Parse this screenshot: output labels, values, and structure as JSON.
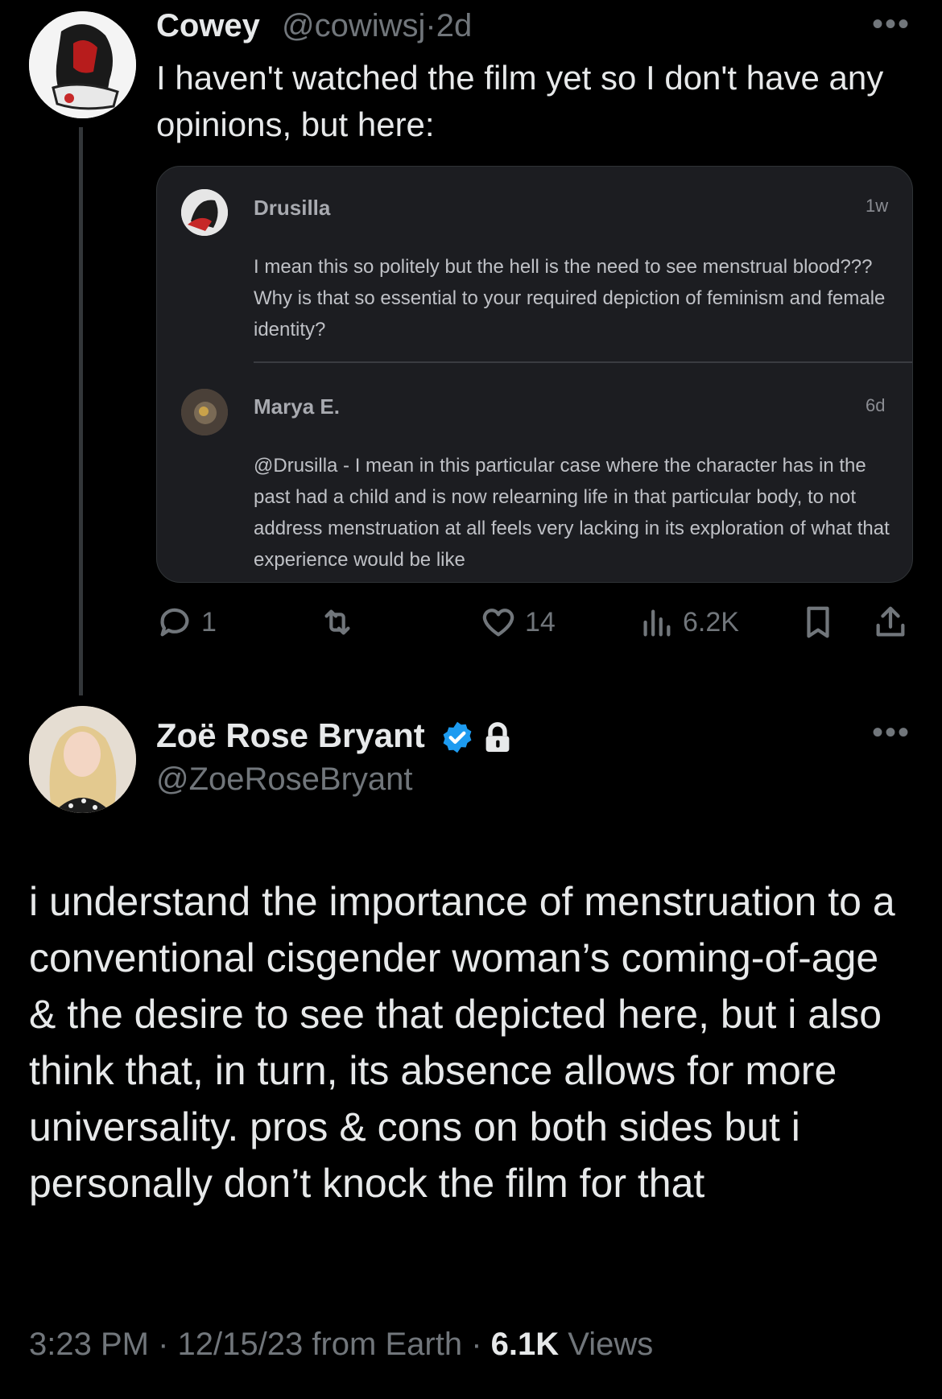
{
  "parent_tweet": {
    "author_name": "Cowey",
    "handle": "@cowiwsj",
    "separator": "·",
    "time": "2d",
    "more": "•••",
    "text": "I haven't watched the film yet so I don't have any opinions, but here:",
    "embedded": {
      "comments": [
        {
          "name": "Drusilla",
          "time": "1w",
          "text": "I mean this so politely but the hell is the need to see menstrual blood??? Why is that so essential to your required depiction of feminism and female identity?"
        },
        {
          "name": "Marya E.",
          "time": "6d",
          "text": "@Drusilla - I mean in this particular case where the character has in the past had a child and is now relearning life in that particular body, to not address menstruation at all feels very lacking in its exploration of what that experience would be like"
        }
      ]
    },
    "actions": {
      "replies": "1",
      "retweets": "",
      "likes": "14",
      "views": "6.2K"
    }
  },
  "main_tweet": {
    "author_name": "Zoë Rose Bryant",
    "handle": "@ZoeRoseBryant",
    "more": "•••",
    "text": "i understand the importance of menstruation to a conventional cisgender woman’s coming-of-age & the desire to see that depicted here, but i also think that, in turn, its absence allows for more universality. pros & cons on both sides but i personally don’t knock the film for that",
    "footer": {
      "time": "3:23 PM",
      "sep1": "·",
      "date": "12/15/23 from Earth",
      "sep2": "·",
      "views_count": "6.1K",
      "views_label": "Views"
    }
  },
  "colors": {
    "background": "#000000",
    "text": "#e7e9ea",
    "secondary": "#71767b",
    "verified": "#1d9bf0",
    "card": "#1c1d21"
  },
  "icons": [
    "reply-icon",
    "retweet-icon",
    "like-icon",
    "views-icon",
    "bookmark-icon",
    "share-icon",
    "verified-badge-icon",
    "lock-icon",
    "more-icon"
  ]
}
